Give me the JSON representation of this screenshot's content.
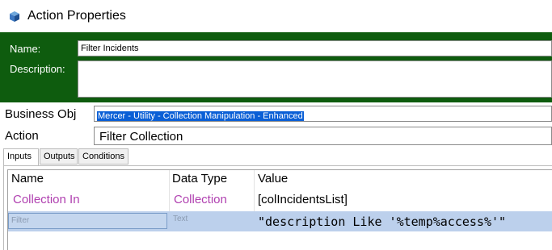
{
  "window": {
    "title": "Action Properties",
    "icon": "action-properties-icon"
  },
  "header": {
    "name_label": "Name:",
    "name_value": "Filter Incidents",
    "description_label": "Description:",
    "description_value": "",
    "panel_color": "#0e5c0e"
  },
  "business_object": {
    "label": "Business Obj",
    "value": "Mercer - Utility - Collection Manipulation - Enhanced",
    "selection_color": "#0a5fd6"
  },
  "action": {
    "label": "Action",
    "value": "Filter Collection"
  },
  "tabs": [
    {
      "label": "Inputs",
      "active": true
    },
    {
      "label": "Outputs",
      "active": false
    },
    {
      "label": "Conditions",
      "active": false
    }
  ],
  "grid": {
    "columns": [
      "Name",
      "Data Type",
      "Value"
    ],
    "rows": [
      {
        "name": "Collection In",
        "type": "Collection",
        "value": "[colIncidentsList]"
      },
      {
        "name": "Filter",
        "type": "Text",
        "value": "\"description Like '%temp%access%'\""
      }
    ],
    "selected_row_color": "#bcd0ec",
    "parameter_color": "#b040b0"
  }
}
